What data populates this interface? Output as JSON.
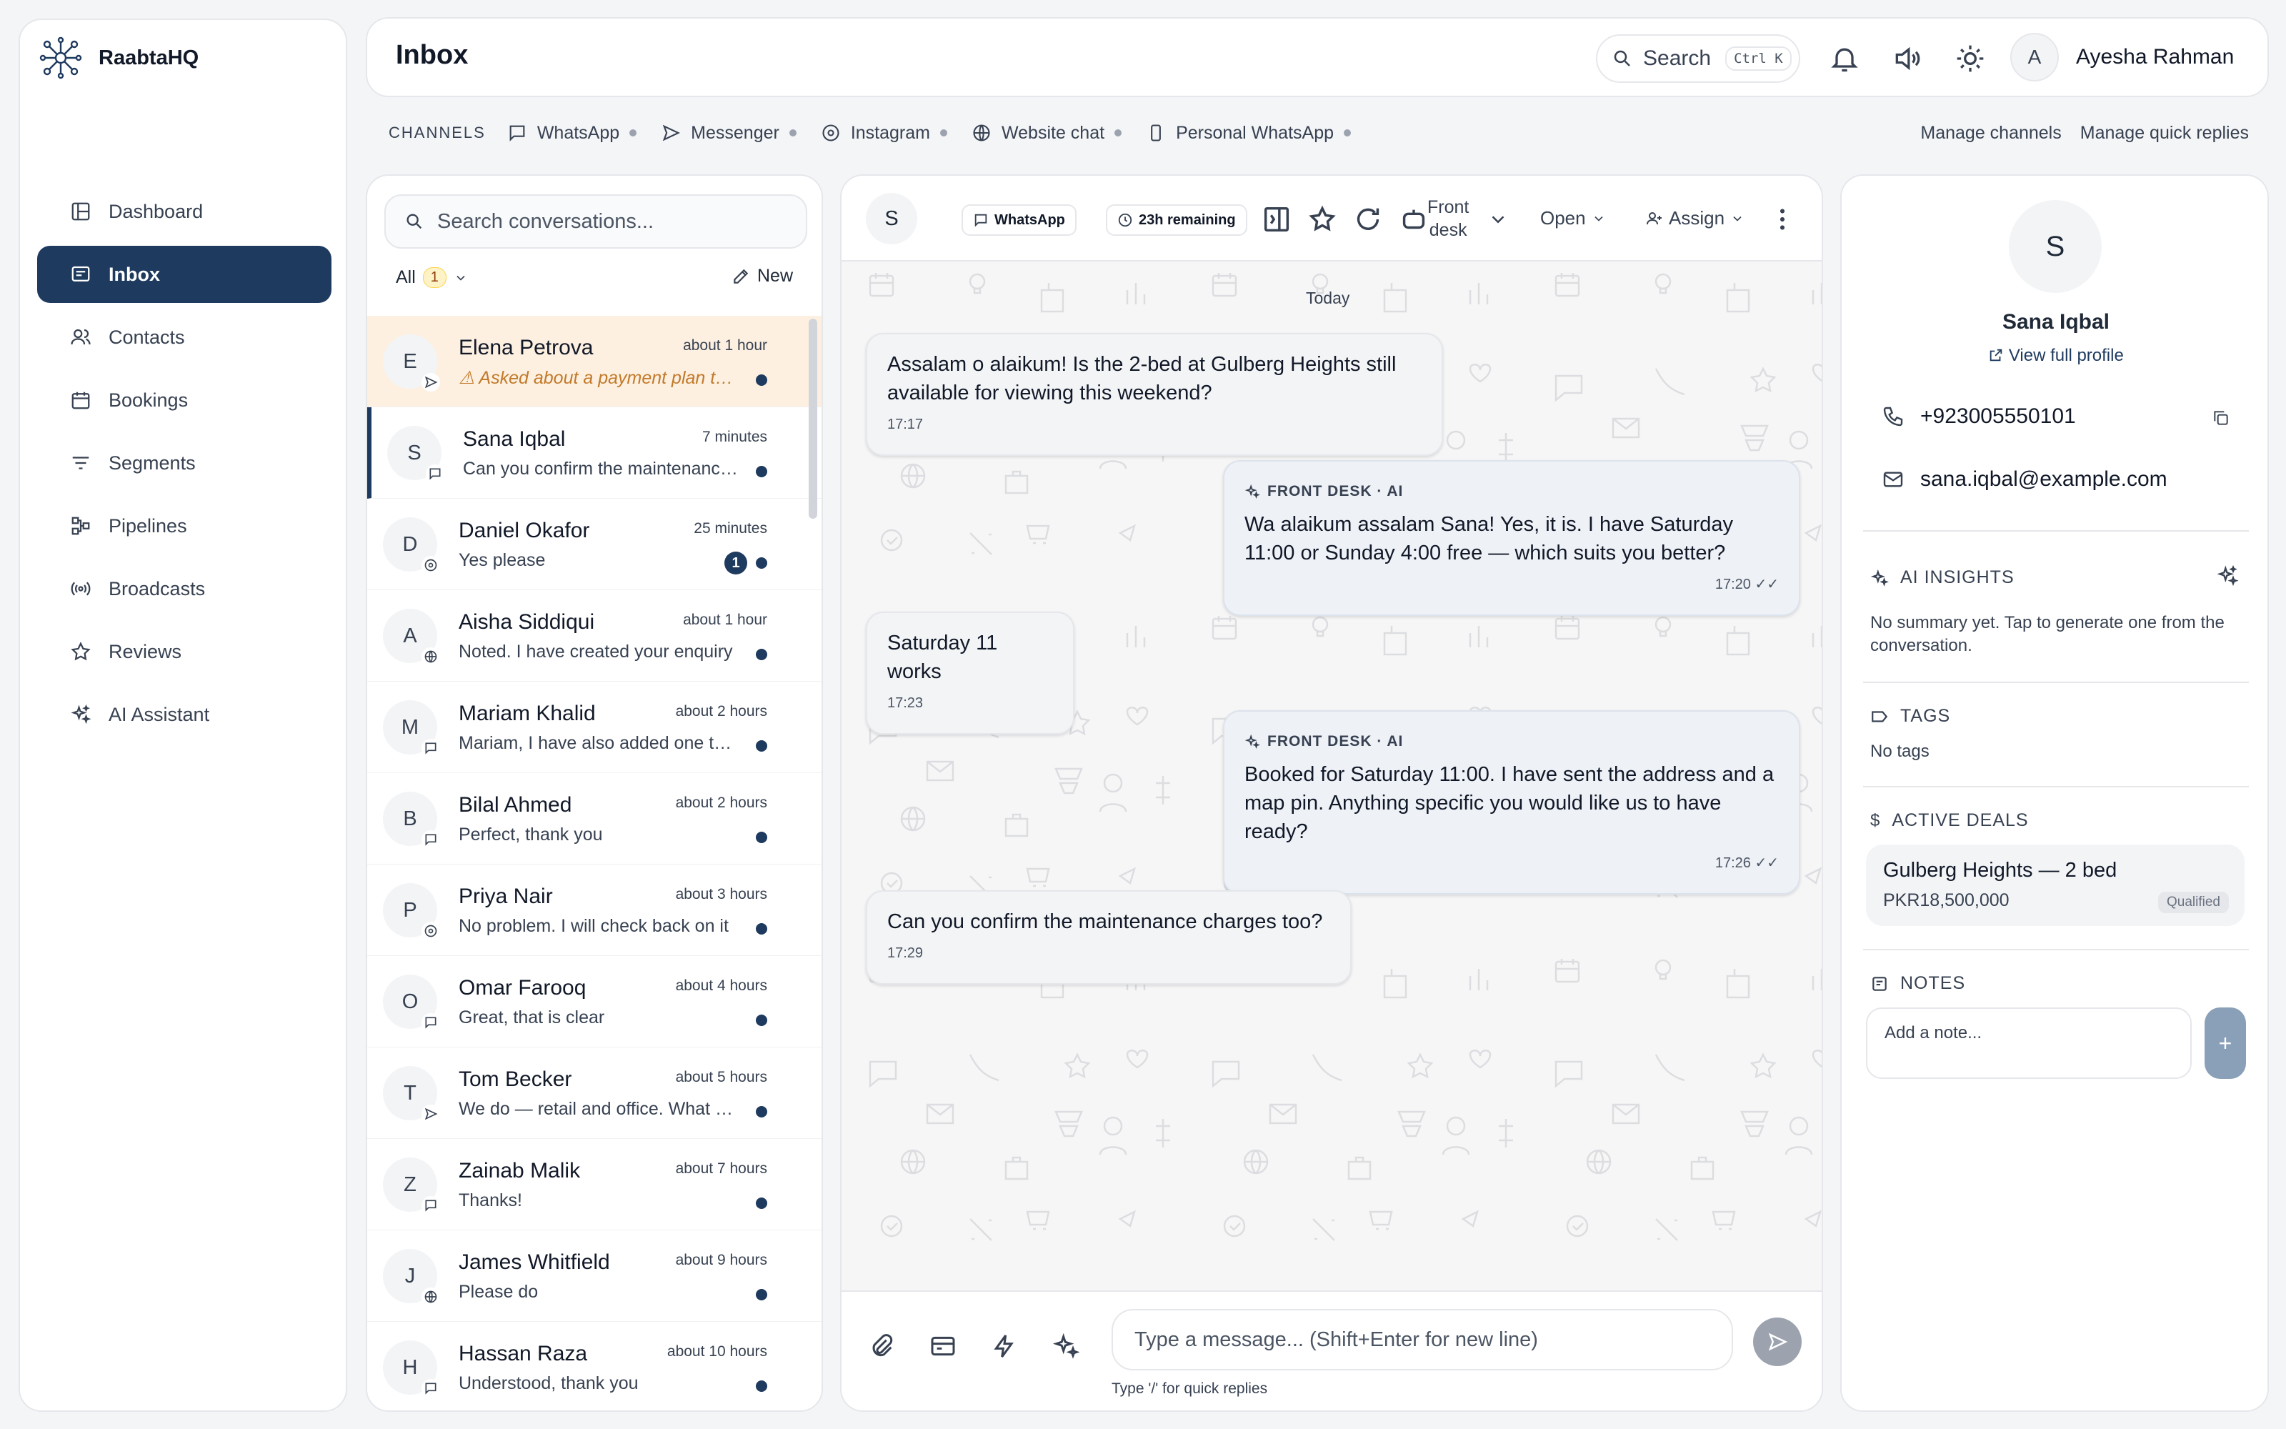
{
  "app": {
    "name": "RaabtaHQ"
  },
  "sidebar": {
    "items": [
      {
        "label": "Dashboard",
        "icon": "dashboard-icon"
      },
      {
        "label": "Inbox",
        "icon": "inbox-icon",
        "active": true
      },
      {
        "label": "Contacts",
        "icon": "contacts-icon"
      },
      {
        "label": "Bookings",
        "icon": "calendar-icon"
      },
      {
        "label": "Segments",
        "icon": "filter-icon"
      },
      {
        "label": "Pipelines",
        "icon": "pipeline-icon"
      },
      {
        "label": "Broadcasts",
        "icon": "broadcast-icon"
      },
      {
        "label": "Reviews",
        "icon": "star-icon"
      },
      {
        "label": "AI Assistant",
        "icon": "sparkle-icon"
      }
    ]
  },
  "header": {
    "title": "Inbox",
    "search_label": "Search",
    "search_kbd": "Ctrl K",
    "user_initial": "A",
    "user_name": "Ayesha Rahman"
  },
  "channels": {
    "label": "CHANNELS",
    "items": [
      "WhatsApp",
      "Messenger",
      "Instagram",
      "Website chat",
      "Personal WhatsApp"
    ],
    "manage_channels": "Manage channels",
    "manage_quick_replies": "Manage quick replies"
  },
  "conversations": {
    "search_placeholder": "Search conversations...",
    "filter_label": "All",
    "filter_count": "1",
    "new_label": "New",
    "items": [
      {
        "initial": "E",
        "name": "Elena Petrova",
        "time": "about 1 hour",
        "preview": "⚠ Asked about a payment plan th…",
        "channel": "messenger"
      },
      {
        "initial": "S",
        "name": "Sana Iqbal",
        "time": "7 minutes",
        "preview": "Can you confirm the maintenance charges too?",
        "channel": "whatsapp"
      },
      {
        "initial": "D",
        "name": "Daniel Okafor",
        "time": "25 minutes",
        "preview": "Yes please",
        "channel": "instagram",
        "unread": "1"
      },
      {
        "initial": "A",
        "name": "Aisha Siddiqui",
        "time": "about 1 hour",
        "preview": "Noted. I have created your enquiry",
        "channel": "web"
      },
      {
        "initial": "M",
        "name": "Mariam Khalid",
        "time": "about 2 hours",
        "preview": "Mariam, I have also added one that",
        "channel": "whatsapp"
      },
      {
        "initial": "B",
        "name": "Bilal Ahmed",
        "time": "about 2 hours",
        "preview": "Perfect, thank you",
        "channel": "whatsapp"
      },
      {
        "initial": "P",
        "name": "Priya Nair",
        "time": "about 3 hours",
        "preview": "No problem. I will check back on it",
        "channel": "instagram"
      },
      {
        "initial": "O",
        "name": "Omar Farooq",
        "time": "about 4 hours",
        "preview": "Great, that is clear",
        "channel": "whatsapp"
      },
      {
        "initial": "T",
        "name": "Tom Becker",
        "time": "about 5 hours",
        "preview": "We do — retail and office. What size",
        "channel": "messenger"
      },
      {
        "initial": "Z",
        "name": "Zainab Malik",
        "time": "about 7 hours",
        "preview": "Thanks!",
        "channel": "whatsapp"
      },
      {
        "initial": "J",
        "name": "James Whitfield",
        "time": "about 9 hours",
        "preview": "Please do",
        "channel": "web"
      },
      {
        "initial": "H",
        "name": "Hassan Raza",
        "time": "about 10 hours",
        "preview": "Understood, thank you",
        "channel": "whatsapp"
      }
    ]
  },
  "chat": {
    "contact_initial": "S",
    "channel_pill": "WhatsApp",
    "window_pill": "23h remaining",
    "team_line1": "Front",
    "team_line2": "desk",
    "status": "Open",
    "assign": "Assign",
    "day_label": "Today",
    "messages": [
      {
        "dir": "in",
        "text": "Assalam o alaikum! Is the 2-bed at Gulberg Heights still available for viewing this weekend?",
        "time": "17:17"
      },
      {
        "dir": "out",
        "sender": "FRONT DESK · AI",
        "text": "Wa alaikum assalam Sana! Yes, it is. I have Saturday 11:00 or Sunday 4:00 free — which suits you better?",
        "time": "17:20"
      },
      {
        "dir": "in",
        "text": "Saturday 11 works",
        "time": "17:23"
      },
      {
        "dir": "out",
        "sender": "FRONT DESK · AI",
        "text": "Booked for Saturday 11:00. I have sent the address and a map pin. Anything specific you would like us to have ready?",
        "time": "17:26"
      },
      {
        "dir": "in",
        "text": "Can you confirm the maintenance charges too?",
        "time": "17:29"
      }
    ],
    "composer_placeholder": "Type a message... (Shift+Enter for new line)",
    "composer_hint": "Type '/' for quick replies"
  },
  "profile": {
    "initial": "S",
    "name": "Sana Iqbal",
    "view_profile": "View full profile",
    "phone": "+923005550101",
    "email": "sana.iqbal@example.com",
    "ai_insights_title": "AI INSIGHTS",
    "ai_insights_text": "No summary yet. Tap to generate one from the conversation.",
    "tags_title": "TAGS",
    "tags_text": "No tags",
    "deals_title": "ACTIVE DEALS",
    "deal": {
      "title": "Gulberg Heights — 2 bed",
      "value": "PKR18,500,000",
      "stage": "Qualified"
    },
    "notes_title": "NOTES",
    "note_placeholder": "Add a note...",
    "add_label": "+"
  }
}
